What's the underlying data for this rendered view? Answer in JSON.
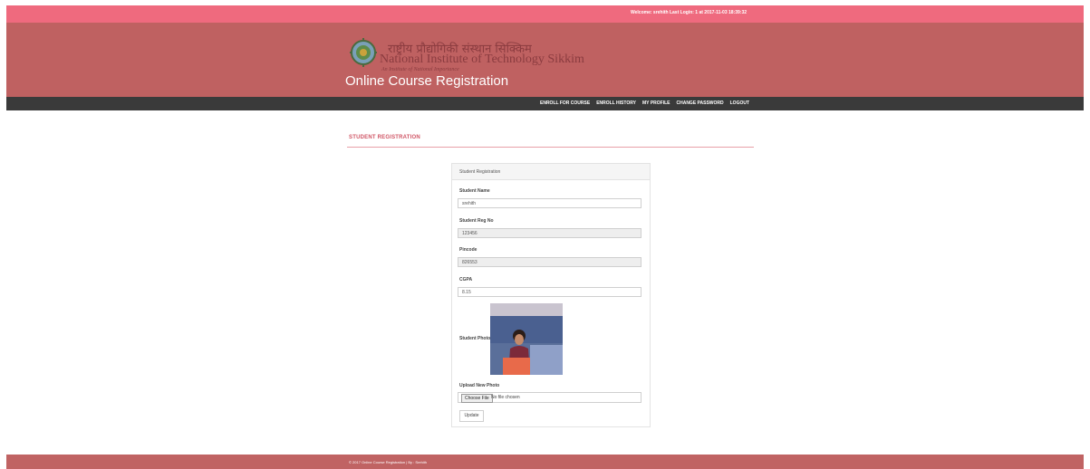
{
  "topbar": {
    "welcome_text": "Welcome: srehith   Last Login: 1 at 2017-11-03 18:39:32"
  },
  "header": {
    "institute_hindi": "राष्ट्रीय प्रौद्योगिकी संस्थान सिक्किम",
    "institute_name": "National Institute of Technology Sikkim",
    "institute_subtitle": "An Institute of National Importance",
    "app_title": "Online Course Registration"
  },
  "nav": {
    "items": [
      {
        "label": "ENROLL FOR COURSE"
      },
      {
        "label": "ENROLL HISTORY"
      },
      {
        "label": "MY PROFILE"
      },
      {
        "label": "CHANGE PASSWORD"
      },
      {
        "label": "LOGOUT"
      }
    ]
  },
  "page": {
    "section_title": "STUDENT REGISTRATION"
  },
  "form": {
    "panel_title": "Student Registration",
    "student_name": {
      "label": "Student Name",
      "value": "srehith"
    },
    "reg_no": {
      "label": "Student Reg No",
      "value": "123456"
    },
    "pincode": {
      "label": "Pincode",
      "value": "826553"
    },
    "cgpa": {
      "label": "CGPA",
      "value": "8.15"
    },
    "photo_label": "Student Photo",
    "upload": {
      "label": "Upload New Photo",
      "button": "Choose File",
      "status": "No file chosen"
    },
    "update_button": "Update"
  },
  "footer": {
    "text": "© 2017 Online Course Registration | By : Srehith"
  },
  "colors": {
    "topbar": "#ef6a7e",
    "header": "#bf6161",
    "navbar": "#3a3a3a",
    "accent": "#d05565",
    "footer": "#c06363"
  }
}
